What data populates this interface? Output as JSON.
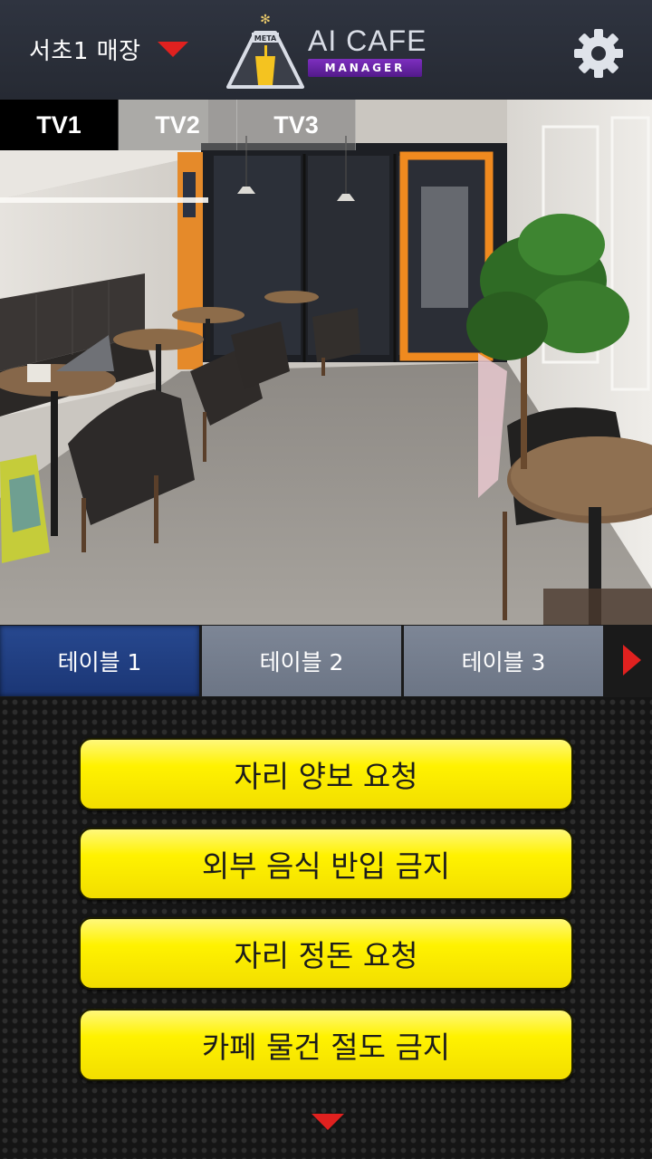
{
  "header": {
    "store_name": "서초1 매장",
    "logo_badge": "META",
    "brand": "AI CAFE",
    "brand_sub": "MANAGER"
  },
  "camera_tabs": [
    {
      "label": "TV1",
      "active": true
    },
    {
      "label": "TV2",
      "active": false
    },
    {
      "label": "TV3",
      "active": false
    }
  ],
  "tables": [
    {
      "label": "테이블 1",
      "active": true
    },
    {
      "label": "테이블 2",
      "active": false
    },
    {
      "label": "테이블 3",
      "active": false
    }
  ],
  "messages": [
    "자리 양보 요청",
    "외부 음식 반입 금지",
    "자리 정돈 요청",
    "카페 물건 절도 금지"
  ],
  "icons": {
    "store_dropdown": "caret-down-icon",
    "settings": "gear-icon",
    "tables_next": "caret-right-icon",
    "messages_more": "caret-down-icon"
  },
  "colors": {
    "header_bg": "#2b2f38",
    "accent_red": "#e0211f",
    "active_table": "#1f3d80",
    "inactive_table": "#737c8c",
    "message_button": "#fff200",
    "brand_purple": "#6a24a8"
  }
}
